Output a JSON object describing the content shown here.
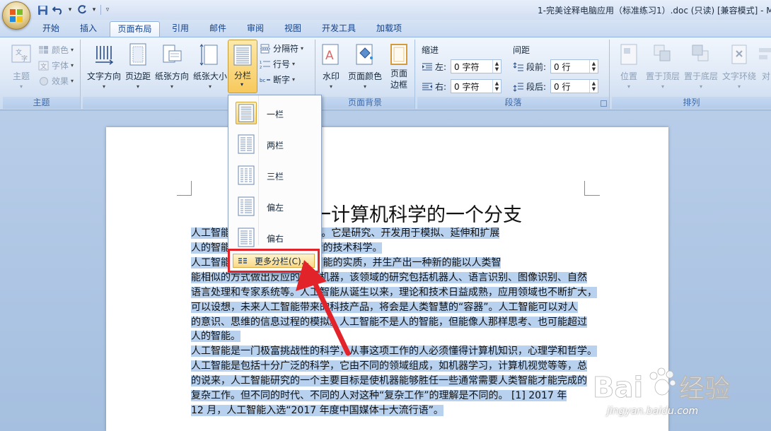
{
  "window": {
    "title": "1-完美诠释电脑应用（标准练习1）.doc (只读) [兼容模式] - M"
  },
  "tabs": [
    "开始",
    "插入",
    "页面布局",
    "引用",
    "邮件",
    "审阅",
    "视图",
    "开发工具",
    "加载项"
  ],
  "active_tab": "页面布局",
  "groups": {
    "theme": {
      "label": "主题",
      "theme_button": "主题",
      "colors": "颜色",
      "fonts": "字体",
      "effects": "效果"
    },
    "page_setup": {
      "label": "页面设置",
      "text_direction": "文字方向",
      "margins": "页边距",
      "orientation": "纸张方向",
      "size": "纸张大小",
      "columns": "分栏",
      "breaks": "分隔符",
      "line_numbers": "行号",
      "hyphenation": "断字"
    },
    "page_background": {
      "label": "页面背景",
      "watermark": "水印",
      "page_color": "页面颜色",
      "page_borders": "页面\n边框"
    },
    "paragraph": {
      "label": "段落",
      "indent_title": "缩进",
      "spacing_title": "间距",
      "indent_left_label": "左:",
      "indent_left_value": "0 字符",
      "indent_right_label": "右:",
      "indent_right_value": "0 字符",
      "spacing_before_label": "段前:",
      "spacing_before_value": "0 行",
      "spacing_after_label": "段后:",
      "spacing_after_value": "0 行"
    },
    "arrange": {
      "label": "排列",
      "position": "位置",
      "bring_front": "置于顶层",
      "send_back": "置于底层",
      "text_wrap": "文字环绕",
      "align": "对"
    }
  },
  "columns_menu": {
    "items": [
      "一栏",
      "两栏",
      "三栏",
      "偏左",
      "偏右"
    ],
    "more": "更多分栏(C)..."
  },
  "document": {
    "heading": "一计算机科学的一个分支",
    "lines": [
      "人工智能                    ce)，英文缩写为 AI。它是研究、开发用于模拟、延伸和扩展",
      "人的智能                         及应用系统的一门新的技术科学。",
      "人工智能                         分支，它企图了解智能的实质，并生产出一种新的能以人类智",
      "能相似的方式做出反应的智能机器，该领域的研究包括机器人、语言识别、图像识别、自然",
      "语言处理和专家系统等。人工智能从诞生以来，理论和技术日益成熟，应用领域也不断扩大，",
      "可以设想，未来人工智能带来的科技产品，将会是人类智慧的“容器”。人工智能可以对人",
      "的意识、思维的信息过程的模拟。人工智能不是人的智能，但能像人那样思考、也可能超过",
      "人的智能。",
      "人工智能是一门极富挑战性的科学，从事这项工作的人必须懂得计算机知识，心理学和哲学。",
      "人工智能是包括十分广泛的科学，它由不同的领域组成，如机器学习，计算机视觉等等，总",
      "的说来，人工智能研究的一个主要目标是使机器能够胜任一些通常需要人类智能才能完成的",
      "复杂工作。但不同的时代、不同的人对这种“复杂工作”的理解是不同的。  [1]  2017 年",
      "12 月，人工智能入选“2017 年度中国媒体十大流行语”。"
    ]
  },
  "watermark": {
    "brand": "Bai",
    "brand_suffix": "经验",
    "url": "jingyan.baidu.com"
  },
  "colors": {
    "highlight": "#b7d1ef",
    "annotation_red": "#e3232a",
    "hover_gold": "#f8d77c"
  }
}
